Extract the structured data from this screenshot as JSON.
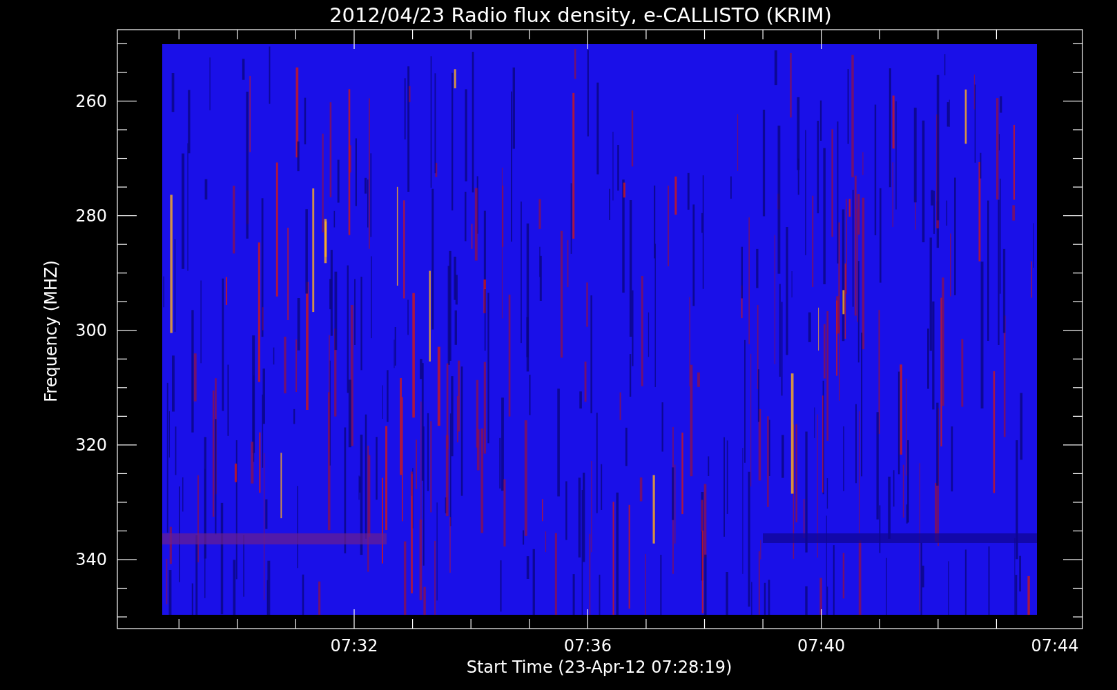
{
  "title": "2012/04/23  Radio flux density, e-CALLISTO (KRIM)",
  "ylabel": "Frequency (MHZ)",
  "xlabel": "Start Time (23-Apr-12 07:28:19)",
  "yticks": [
    "260",
    "280",
    "300",
    "320",
    "340"
  ],
  "xticks": [
    "07:32",
    "07:36",
    "07:40",
    "07:44"
  ]
}
